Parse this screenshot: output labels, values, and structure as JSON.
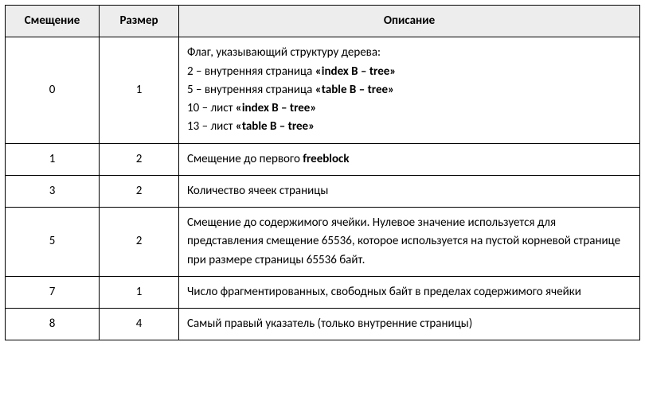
{
  "headers": {
    "offset": "Смещение",
    "size": "Размер",
    "desc": "Описание"
  },
  "rows": [
    {
      "offset": "0",
      "size": "1",
      "desc_lines": [
        [
          {
            "t": "Флаг, указывающий структуру дерева:",
            "b": false
          }
        ],
        [
          {
            "t": "2 – внутренняя страница ",
            "b": false
          },
          {
            "t": "«index B – tree»",
            "b": true
          }
        ],
        [
          {
            "t": "5 – внутренняя страница ",
            "b": false
          },
          {
            "t": "«table B – tree»",
            "b": true
          }
        ],
        [
          {
            "t": "10 – лист ",
            "b": false
          },
          {
            "t": "«index B – tree»",
            "b": true
          }
        ],
        [
          {
            "t": "13 – лист ",
            "b": false
          },
          {
            "t": "«table B – tree»",
            "b": true
          }
        ]
      ]
    },
    {
      "offset": "1",
      "size": "2",
      "desc_lines": [
        [
          {
            "t": "Смещение до первого ",
            "b": false
          },
          {
            "t": "freeblock",
            "b": true
          }
        ]
      ]
    },
    {
      "offset": "3",
      "size": "2",
      "desc_lines": [
        [
          {
            "t": "Количество ячеек страницы",
            "b": false
          }
        ]
      ]
    },
    {
      "offset": "5",
      "size": "2",
      "desc_lines": [
        [
          {
            "t": "Смещение до содержимого ячейки. Нулевое значение используется для представления смещение 65536, которое используется на пустой корневой странице при размере страницы 65536 байт.",
            "b": false
          }
        ]
      ]
    },
    {
      "offset": "7",
      "size": "1",
      "desc_lines": [
        [
          {
            "t": "Число фрагментированных, свободных байт в пределах содержимого ячейки",
            "b": false
          }
        ]
      ]
    },
    {
      "offset": "8",
      "size": "4",
      "desc_lines": [
        [
          {
            "t": "Самый правый указатель (только внутренние страницы)",
            "b": false
          }
        ]
      ]
    }
  ]
}
